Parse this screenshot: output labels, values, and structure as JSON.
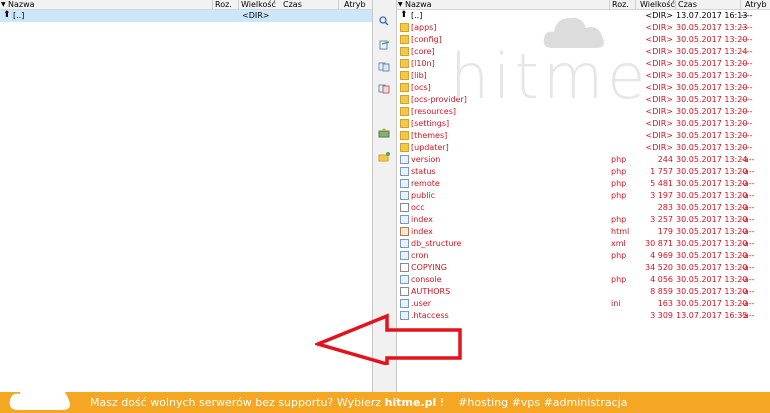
{
  "left_pane": {
    "columns": {
      "name": "Nazwa",
      "ext": "Roz.",
      "size": "Wielkość",
      "time": "Czas",
      "attr": "Atryb"
    },
    "rows": [
      {
        "name": "[..]",
        "size": "<DIR>"
      }
    ]
  },
  "right_pane": {
    "columns": {
      "name": "Nazwa",
      "ext": "Roz.",
      "size": "Wielkość",
      "time": "Czas",
      "attr": "Atryb"
    },
    "rows": [
      {
        "type": "up",
        "name": "[..]",
        "ext": "",
        "size": "<DIR>",
        "time": "13.07.2017 16:13",
        "attr": "----"
      },
      {
        "type": "folder",
        "name": "[apps]",
        "ext": "",
        "size": "<DIR>",
        "time": "30.05.2017 13:23",
        "attr": "----"
      },
      {
        "type": "folder",
        "name": "[config]",
        "ext": "",
        "size": "<DIR>",
        "time": "30.05.2017 13:20",
        "attr": "----"
      },
      {
        "type": "folder",
        "name": "[core]",
        "ext": "",
        "size": "<DIR>",
        "time": "30.05.2017 13:24",
        "attr": "----"
      },
      {
        "type": "folder",
        "name": "[l10n]",
        "ext": "",
        "size": "<DIR>",
        "time": "30.05.2017 13:20",
        "attr": "----"
      },
      {
        "type": "folder",
        "name": "[lib]",
        "ext": "",
        "size": "<DIR>",
        "time": "30.05.2017 13:20",
        "attr": "----"
      },
      {
        "type": "folder",
        "name": "[ocs]",
        "ext": "",
        "size": "<DIR>",
        "time": "30.05.2017 13:20",
        "attr": "----"
      },
      {
        "type": "folder",
        "name": "[ocs-provider]",
        "ext": "",
        "size": "<DIR>",
        "time": "30.05.2017 13:20",
        "attr": "----"
      },
      {
        "type": "folder",
        "name": "[resources]",
        "ext": "",
        "size": "<DIR>",
        "time": "30.05.2017 13:20",
        "attr": "----"
      },
      {
        "type": "folder",
        "name": "[settings]",
        "ext": "",
        "size": "<DIR>",
        "time": "30.05.2017 13:20",
        "attr": "----"
      },
      {
        "type": "folder",
        "name": "[themes]",
        "ext": "",
        "size": "<DIR>",
        "time": "30.05.2017 13:20",
        "attr": "----"
      },
      {
        "type": "folder",
        "name": "[updater]",
        "ext": "",
        "size": "<DIR>",
        "time": "30.05.2017 13:20",
        "attr": "----"
      },
      {
        "type": "file",
        "name": "version",
        "ext": "php",
        "size": "244",
        "time": "30.05.2017 13:24",
        "attr": "-a--"
      },
      {
        "type": "file",
        "name": "status",
        "ext": "php",
        "size": "1 757",
        "time": "30.05.2017 13:20",
        "attr": "-a--"
      },
      {
        "type": "file",
        "name": "remote",
        "ext": "php",
        "size": "5 481",
        "time": "30.05.2017 13:20",
        "attr": "-a--"
      },
      {
        "type": "file",
        "name": "public",
        "ext": "php",
        "size": "3 197",
        "time": "30.05.2017 13:20",
        "attr": "-a--"
      },
      {
        "type": "plain",
        "name": "occ",
        "ext": "",
        "size": "283",
        "time": "30.05.2017 13:20",
        "attr": "-a--"
      },
      {
        "type": "file",
        "name": "index",
        "ext": "php",
        "size": "3 257",
        "time": "30.05.2017 13:20",
        "attr": "-a--"
      },
      {
        "type": "html",
        "name": "index",
        "ext": "html",
        "size": "179",
        "time": "30.05.2017 13:20",
        "attr": "-a--"
      },
      {
        "type": "file",
        "name": "db_structure",
        "ext": "xml",
        "size": "30 871",
        "time": "30.05.2017 13:20",
        "attr": "-a--"
      },
      {
        "type": "file",
        "name": "cron",
        "ext": "php",
        "size": "4 969",
        "time": "30.05.2017 13:20",
        "attr": "-a--"
      },
      {
        "type": "plain",
        "name": "COPYING",
        "ext": "",
        "size": "34 520",
        "time": "30.05.2017 13:20",
        "attr": "-a--"
      },
      {
        "type": "file",
        "name": "console",
        "ext": "php",
        "size": "4 056",
        "time": "30.05.2017 13:20",
        "attr": "-a--"
      },
      {
        "type": "plain",
        "name": "AUTHORS",
        "ext": "",
        "size": "8 859",
        "time": "30.05.2017 13:20",
        "attr": "-a--"
      },
      {
        "type": "file",
        "name": ".user",
        "ext": "ini",
        "size": "163",
        "time": "30.05.2017 13:20",
        "attr": "-a--"
      },
      {
        "type": "file",
        "name": ".htaccess",
        "ext": "",
        "size": "3 309",
        "time": "13.07.2017 16:35",
        "attr": "-a--"
      }
    ]
  },
  "toolbar": {
    "icons": [
      "search-icon",
      "edit-icon",
      "copy-icon",
      "move-icon",
      "sync-icon",
      "new-folder-icon"
    ]
  },
  "watermark": {
    "text": "hitme"
  },
  "banner": {
    "text_prefix": "Masz dość wolnych serwerów bez supportu? Wybierz ",
    "brand": "hitme.pl",
    "text_suffix": " !",
    "tags": "#hosting #vps #administracja"
  },
  "colors": {
    "accent": "#f5a623",
    "file_text": "#d4141e",
    "selection": "#cde6fa",
    "arrow": "#e3131b"
  }
}
